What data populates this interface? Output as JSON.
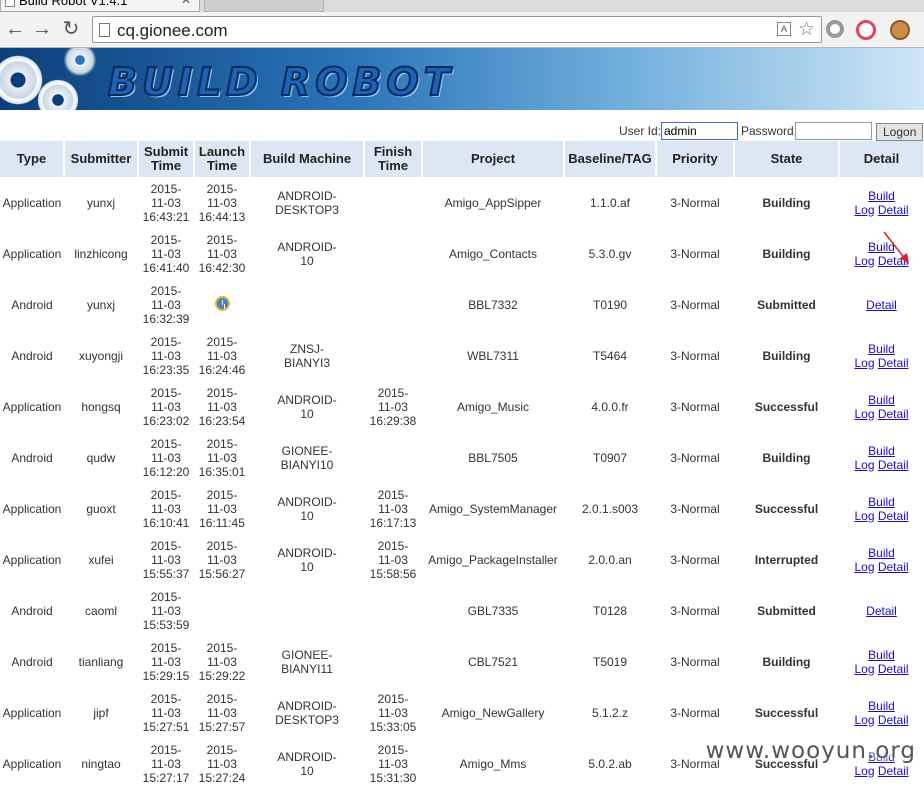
{
  "browser": {
    "tab_title": "Build Robot V1.4.1",
    "url": "cq.gionee.com"
  },
  "banner": {
    "logo_text": "BUILD ROBOT"
  },
  "login": {
    "user_label": "User Id:",
    "user_value": "admin",
    "password_label": "Password:",
    "password_value": "",
    "logon_label": "Logon"
  },
  "table": {
    "headers": [
      "Type",
      "Submitter",
      "Submit Time",
      "Launch Time",
      "Build Machine",
      "Finish Time",
      "Project",
      "Baseline/TAG",
      "Priority",
      "State",
      "Detail"
    ],
    "build_label": "Build",
    "log_label": "Log",
    "detail_label": "Detail",
    "rows": [
      {
        "type": "Application",
        "submitter": "yunxj",
        "submit_date": "2015-11-03",
        "submit_clock": "16:43:21",
        "launch_date": "2015-11-03",
        "launch_clock": "16:44:13",
        "machine": "ANDROID-DESKTOP3",
        "finish_date": "",
        "finish_clock": "",
        "project": "Amigo_AppSipper",
        "baseline": "1.1.0.af",
        "priority": "3-Normal",
        "state": "Building"
      },
      {
        "type": "Application",
        "submitter": "linzhicong",
        "submit_date": "2015-11-03",
        "submit_clock": "16:41:40",
        "launch_date": "2015-11-03",
        "launch_clock": "16:42:30",
        "machine": "ANDROID-10",
        "finish_date": "",
        "finish_clock": "",
        "project": "Amigo_Contacts",
        "baseline": "5.3.0.gv",
        "priority": "3-Normal",
        "state": "Building"
      },
      {
        "type": "Android",
        "submitter": "yunxj",
        "submit_date": "2015-11-03",
        "submit_clock": "16:32:39",
        "launch_date": "",
        "launch_clock": "",
        "machine": "",
        "finish_date": "",
        "finish_clock": "",
        "project": "BBL7332",
        "baseline": "T0190",
        "priority": "3-Normal",
        "state": "Submitted"
      },
      {
        "type": "Android",
        "submitter": "xuyongji",
        "submit_date": "2015-11-03",
        "submit_clock": "16:23:35",
        "launch_date": "2015-11-03",
        "launch_clock": "16:24:46",
        "machine": "ZNSJ-BIANYI3",
        "finish_date": "",
        "finish_clock": "",
        "project": "WBL7311",
        "baseline": "T5464",
        "priority": "3-Normal",
        "state": "Building"
      },
      {
        "type": "Application",
        "submitter": "hongsq",
        "submit_date": "2015-11-03",
        "submit_clock": "16:23:02",
        "launch_date": "2015-11-03",
        "launch_clock": "16:23:54",
        "machine": "ANDROID-10",
        "finish_date": "2015-11-03",
        "finish_clock": "16:29:38",
        "project": "Amigo_Music",
        "baseline": "4.0.0.fr",
        "priority": "3-Normal",
        "state": "Successful"
      },
      {
        "type": "Android",
        "submitter": "qudw",
        "submit_date": "2015-11-03",
        "submit_clock": "16:12:20",
        "launch_date": "2015-11-03",
        "launch_clock": "16:35:01",
        "machine": "GIONEE-BIANYI10",
        "finish_date": "",
        "finish_clock": "",
        "project": "BBL7505",
        "baseline": "T0907",
        "priority": "3-Normal",
        "state": "Building"
      },
      {
        "type": "Application",
        "submitter": "guoxt",
        "submit_date": "2015-11-03",
        "submit_clock": "16:10:41",
        "launch_date": "2015-11-03",
        "launch_clock": "16:11:45",
        "machine": "ANDROID-10",
        "finish_date": "2015-11-03",
        "finish_clock": "16:17:13",
        "project": "Amigo_SystemManager",
        "baseline": "2.0.1.s003",
        "priority": "3-Normal",
        "state": "Successful"
      },
      {
        "type": "Application",
        "submitter": "xufei",
        "submit_date": "2015-11-03",
        "submit_clock": "15:55:37",
        "launch_date": "2015-11-03",
        "launch_clock": "15:56:27",
        "machine": "ANDROID-10",
        "finish_date": "2015-11-03",
        "finish_clock": "15:58:56",
        "project": "Amigo_PackageInstaller",
        "baseline": "2.0.0.an",
        "priority": "3-Normal",
        "state": "Interrupted"
      },
      {
        "type": "Android",
        "submitter": "caoml",
        "submit_date": "2015-11-03",
        "submit_clock": "15:53:59",
        "launch_date": "",
        "launch_clock": "",
        "machine": "",
        "finish_date": "",
        "finish_clock": "",
        "project": "GBL7335",
        "baseline": "T0128",
        "priority": "3-Normal",
        "state": "Submitted"
      },
      {
        "type": "Android",
        "submitter": "tianliang",
        "submit_date": "2015-11-03",
        "submit_clock": "15:29:15",
        "launch_date": "2015-11-03",
        "launch_clock": "15:29:22",
        "machine": "GIONEE-BIANYI11",
        "finish_date": "",
        "finish_clock": "",
        "project": "CBL7521",
        "baseline": "T5019",
        "priority": "3-Normal",
        "state": "Building"
      },
      {
        "type": "Application",
        "submitter": "jipf",
        "submit_date": "2015-11-03",
        "submit_clock": "15:27:51",
        "launch_date": "2015-11-03",
        "launch_clock": "15:27:57",
        "machine": "ANDROID-DESKTOP3",
        "finish_date": "2015-11-03",
        "finish_clock": "15:33:05",
        "project": "Amigo_NewGallery",
        "baseline": "5.1.2.z",
        "priority": "3-Normal",
        "state": "Successful"
      },
      {
        "type": "Application",
        "submitter": "ningtao",
        "submit_date": "2015-11-03",
        "submit_clock": "15:27:17",
        "launch_date": "2015-11-03",
        "launch_clock": "15:27:24",
        "machine": "ANDROID-10",
        "finish_date": "2015-11-03",
        "finish_clock": "15:31:30",
        "project": "Amigo_Mms",
        "baseline": "5.0.2.ab",
        "priority": "3-Normal",
        "state": "Successful"
      }
    ]
  },
  "state_colors": {
    "Building": "#f2b705",
    "Submitted": "#111111",
    "Successful": "#1d8a1d",
    "Interrupted": "#7a7a7a"
  },
  "watermark": "www.wooyun.org"
}
